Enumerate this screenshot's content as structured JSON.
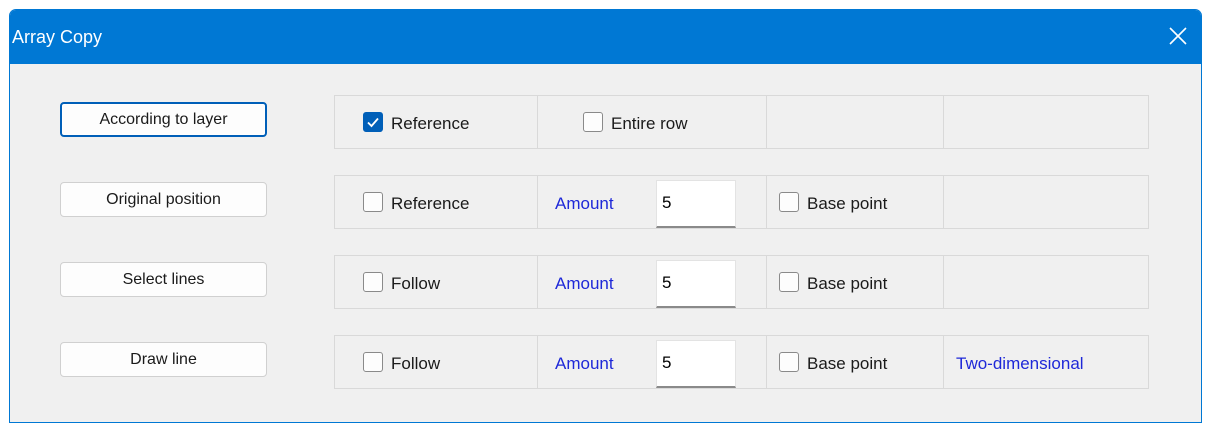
{
  "window": {
    "title": "Array Copy",
    "close_glyph": "close-icon"
  },
  "colors": {
    "accent": "#0078d4",
    "link_text": "#1e28d8",
    "background": "#f0f0f0"
  },
  "rows": [
    {
      "button": "According to layer",
      "checkbox1": {
        "label": "Reference",
        "checked": true
      },
      "checkbox2": {
        "label": "Entire row",
        "checked": false
      }
    },
    {
      "button": "Original position",
      "checkbox1": {
        "label": "Reference",
        "checked": false
      },
      "amount_label": "Amount",
      "amount_value": "5",
      "base_point": {
        "label": "Base point",
        "checked": false
      }
    },
    {
      "button": "Select lines",
      "checkbox1": {
        "label": "Follow",
        "checked": false
      },
      "amount_label": "Amount",
      "amount_value": "5",
      "base_point": {
        "label": "Base point",
        "checked": false
      }
    },
    {
      "button": "Draw line",
      "checkbox1": {
        "label": "Follow",
        "checked": false
      },
      "amount_label": "Amount",
      "amount_value": "5",
      "base_point": {
        "label": "Base point",
        "checked": false
      },
      "extra_label": "Two-dimensional"
    }
  ]
}
